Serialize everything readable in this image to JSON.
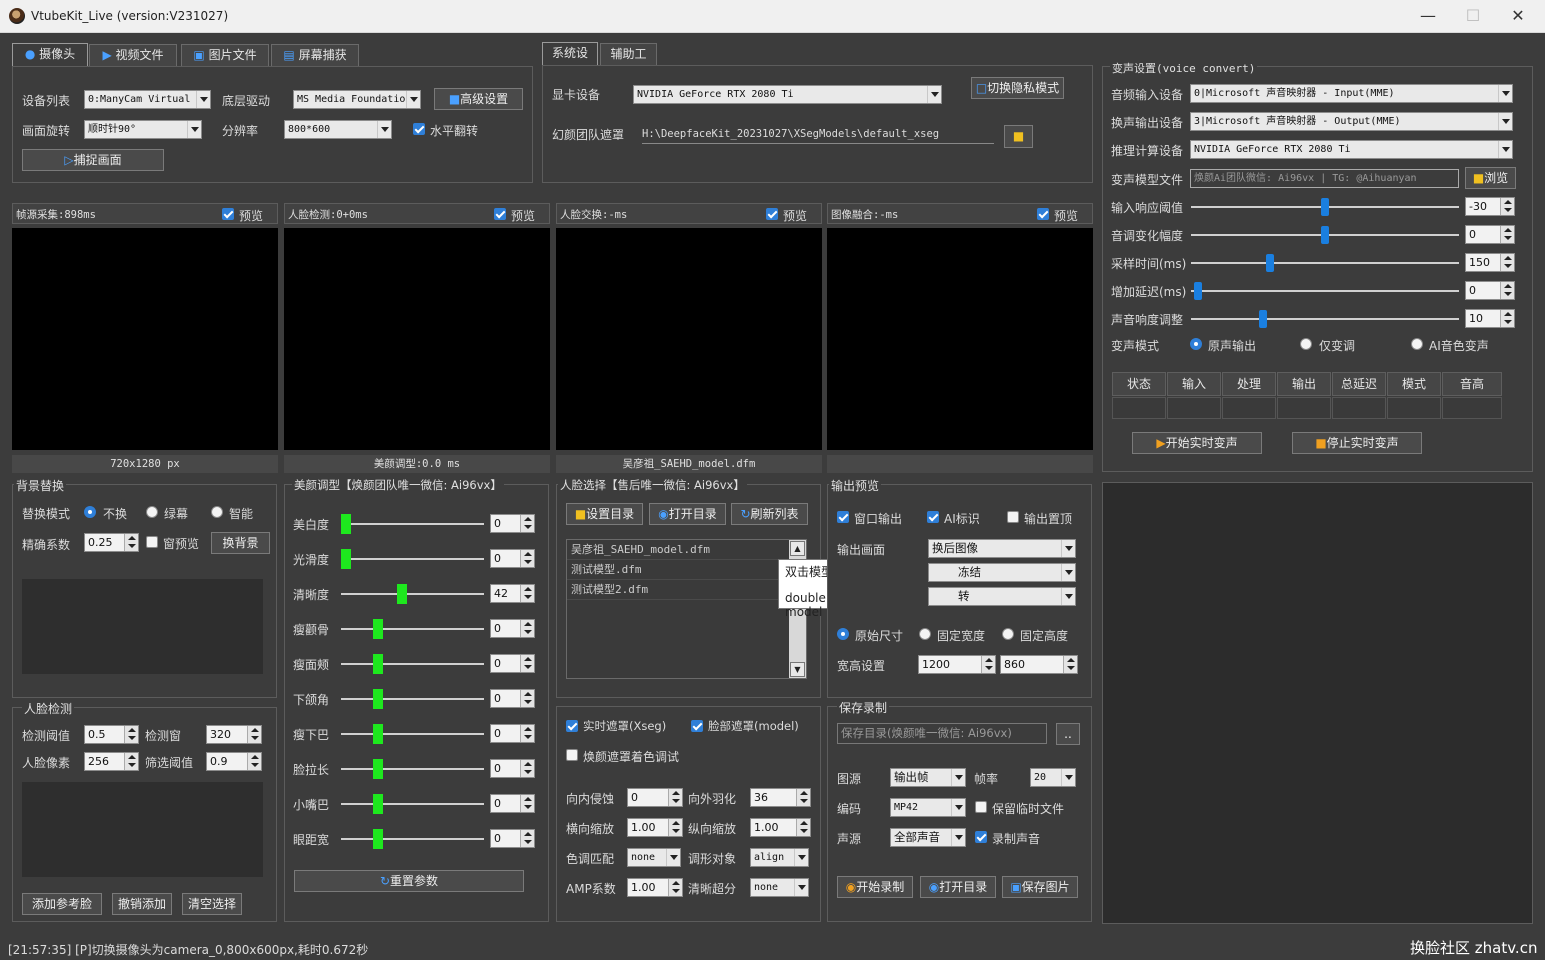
{
  "window": {
    "title": "VtubeKit_Live (version:V231027)"
  },
  "source_tabs": [
    "摄像头",
    "视频文件",
    "图片文件",
    "屏幕捕获"
  ],
  "camera": {
    "device_list_label": "设备列表",
    "device_value": "0:ManyCam Virtual",
    "driver_label": "底层驱动",
    "driver_value": "MS Media Foundatio",
    "advanced_button": "高级设置",
    "rotation_label": "画面旋转",
    "rotation_value": "顺时针90°",
    "resolution_label": "分辨率",
    "resolution_value": "800*600",
    "hflip_label": "水平翻转",
    "hflip_checked": true,
    "capture_button": "捕捉画面"
  },
  "system_tabs": [
    "系统设置",
    "辅助工具"
  ],
  "system": {
    "gpu_label": "显卡设备",
    "gpu_value": "NVIDIA GeForce RTX 2080 Ti",
    "privacy_button": "切换隐私模式",
    "mask_label": "幻颜团队遮罩",
    "mask_path": "H:\\DeepfaceKit_20231027\\XSegModels\\default_xseg"
  },
  "voice": {
    "title": "变声设置(voice convert)",
    "input_label": "音频输入设备",
    "input_value": "0|Microsoft 声音映射器 - Input(MME)",
    "output_label": "换声输出设备",
    "output_value": "3|Microsoft 声音映射器 - Output(MME)",
    "compute_label": "推理计算设备",
    "compute_value": "NVIDIA GeForce RTX 2080 Ti",
    "model_label": "变声模型文件",
    "model_placeholder": "焕颜Ai团队微信: Ai96vx | TG: @Aihuanyan",
    "browse_button": "浏览",
    "sliders": [
      {
        "label": "输入响应阈值",
        "value": "-30",
        "pos": 0.5
      },
      {
        "label": "音调变化幅度",
        "value": "0",
        "pos": 0.5
      },
      {
        "label": "采样时间(ms)",
        "value": "150",
        "pos": 0.29
      },
      {
        "label": "增加延迟(ms)",
        "value": "0",
        "pos": 0.01
      },
      {
        "label": "声音响度调整",
        "value": "10",
        "pos": 0.26
      }
    ],
    "mode_label": "变声模式",
    "modes": [
      "原声输出",
      "仅变调",
      "AI音色变声"
    ],
    "mode_selected": 0,
    "table_headers": [
      "状态",
      "输入",
      "处理",
      "输出",
      "总延迟",
      "模式",
      "音高"
    ],
    "start_button": "开始实时变声",
    "stop_button": "停止实时变声"
  },
  "previews": [
    {
      "title": "帧源采集:898ms",
      "preview_label": "预览",
      "footer": "720x1280 px"
    },
    {
      "title": "人脸检测:0+0ms",
      "preview_label": "预览",
      "footer": "美颜调型:0.0 ms"
    },
    {
      "title": "人脸交换:-ms",
      "preview_label": "预览",
      "footer": "吴彦祖_SAEHD_model.dfm"
    },
    {
      "title": "图像融合:-ms",
      "preview_label": "预览",
      "footer": ""
    }
  ],
  "background": {
    "title": "背景替换",
    "mode_label": "替换模式",
    "modes": [
      "不换",
      "绿幕",
      "智能"
    ],
    "mode_selected": 0,
    "precision_label": "精确系数",
    "precision_value": "0.25",
    "window_preview_label": "窗预览",
    "change_bg_button": "换背景"
  },
  "detect": {
    "title": "人脸检测",
    "threshold_label": "检测阈值",
    "threshold_value": "0.5",
    "window_label": "检测窗",
    "window_value": "320",
    "pixel_label": "人脸像素",
    "pixel_value": "256",
    "filter_label": "筛选阈值",
    "filter_value": "0.9",
    "add_ref_button": "添加参考脸",
    "undo_button": "撤销添加",
    "clear_button": "清空选择"
  },
  "beauty": {
    "title": "美颜调型【焕颜团队唯一微信: Ai96vx】",
    "sliders": [
      {
        "label": "美白度",
        "value": "0",
        "pos": 0.0
      },
      {
        "label": "光滑度",
        "value": "0",
        "pos": 0.0
      },
      {
        "label": "清晰度",
        "value": "42",
        "pos": 0.42
      },
      {
        "label": "瘦颧骨",
        "value": "0",
        "pos": 0.24
      },
      {
        "label": "瘦面颊",
        "value": "0",
        "pos": 0.24
      },
      {
        "label": "下颌角",
        "value": "0",
        "pos": 0.24
      },
      {
        "label": "瘦下巴",
        "value": "0",
        "pos": 0.24
      },
      {
        "label": "脸拉长",
        "value": "0",
        "pos": 0.24
      },
      {
        "label": "小嘴巴",
        "value": "0",
        "pos": 0.24
      },
      {
        "label": "眼距宽",
        "value": "0",
        "pos": 0.24
      }
    ],
    "reset_button": "重置参数"
  },
  "faceselect": {
    "title": "人脸选择【售后唯一微信: Ai96vx】",
    "set_dir_button": "设置目录",
    "open_dir_button": "打开目录",
    "refresh_button": "刷新列表",
    "models": [
      "吴彦祖_SAEHD_model.dfm",
      "测试模型.dfm",
      "测试模型2.dfm"
    ],
    "tooltip_cn": "双击模型名称切换模型",
    "tooltip_en": "double click to switch model"
  },
  "mask": {
    "realtime_label": "实时遮罩(Xseg)",
    "realtime_checked": true,
    "face_label": "脸部遮罩(model)",
    "face_checked": true,
    "color_label": "焕颜遮罩着色调试",
    "color_checked": false,
    "erode_label": "向内侵蚀",
    "erode_value": "0",
    "feather_label": "向外羽化",
    "feather_value": "36",
    "hscale_label": "横向缩放",
    "hscale_value": "1.00",
    "vscale_label": "纵向缩放",
    "vscale_value": "1.00",
    "color_match_label": "色调匹配",
    "color_match_value": "none",
    "shape_label": "调形对象",
    "shape_value": "align",
    "amp_label": "AMP系数",
    "amp_value": "1.00",
    "superres_label": "清晰超分",
    "superres_value": "none"
  },
  "output": {
    "title": "输出预览",
    "window_out_label": "窗口输出",
    "window_out_checked": true,
    "ai_mark_label": "AI标识",
    "ai_mark_checked": true,
    "ontop_label": "输出置顶",
    "ontop_checked": false,
    "screen_label": "输出画面",
    "screen_value": "换后图像",
    "row2_value": "冻结",
    "row3_value": "转",
    "size_modes": [
      "原始尺寸",
      "固定宽度",
      "固定高度"
    ],
    "size_selected": 0,
    "wh_label": "宽高设置",
    "width_value": "1200",
    "height_value": "860"
  },
  "record": {
    "title": "保存录制",
    "dir_placeholder": "保存目录(焕颜唯一微信: Ai96vx)",
    "dots": "..",
    "source_label": "图源",
    "source_value": "输出帧",
    "fps_label": "帧率",
    "fps_value": "20",
    "codec_label": "编码",
    "codec_value": "MP42",
    "keep_temp_label": "保留临时文件",
    "keep_temp_checked": false,
    "audio_label": "声源",
    "audio_value": "全部声音",
    "rec_audio_label": "录制声音",
    "rec_audio_checked": true,
    "start_button": "开始录制",
    "open_button": "打开目录",
    "save_img_button": "保存图片"
  },
  "status": {
    "message": "[21:57:35] [P]切换摄像头为camera_0,800x600px,耗时0.672秒",
    "watermark": "换脸社区 zhatv.cn"
  },
  "colors": {
    "accent": "#2f7fd8",
    "slider_green": "#1ee81e",
    "background": "#3c3c3c"
  }
}
